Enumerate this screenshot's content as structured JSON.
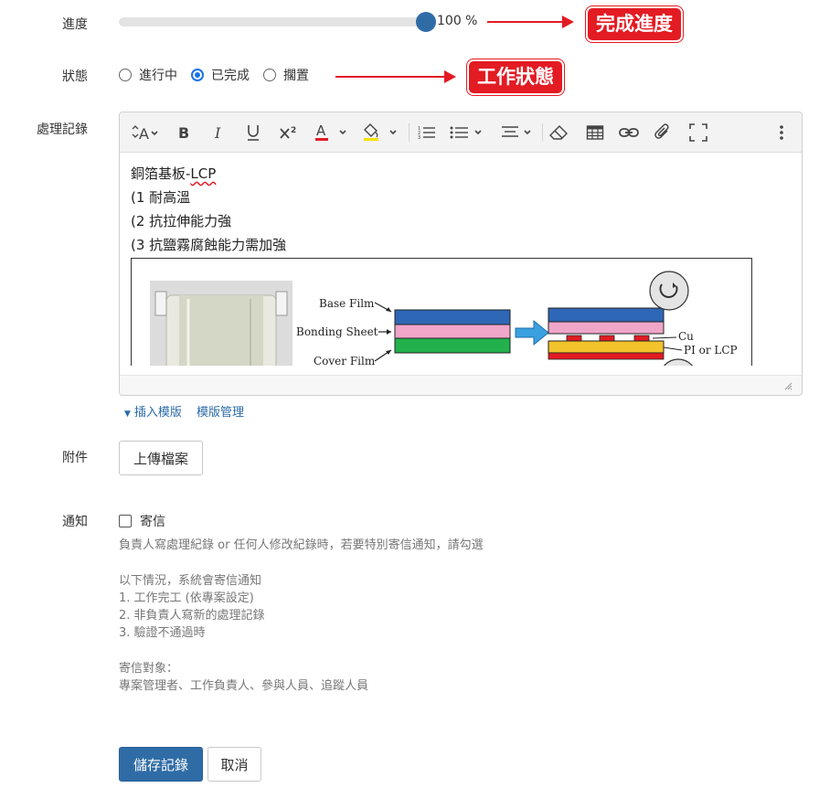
{
  "progress": {
    "label": "進度",
    "value": 1.0,
    "value_text": "100 %"
  },
  "callouts": {
    "progress": "完成進度",
    "status": "工作狀態"
  },
  "status": {
    "label": "狀態",
    "options": [
      {
        "label": "進行中",
        "selected": false
      },
      {
        "label": "已完成",
        "selected": true
      },
      {
        "label": "擱置",
        "selected": false
      }
    ]
  },
  "record": {
    "label": "處理記錄",
    "toolbar": [
      "font-size-icon",
      "bold-icon",
      "italic-icon",
      "underline-icon",
      "superscript-icon",
      "text-color-icon",
      "highlight-icon",
      "ordered-list-icon",
      "bullet-list-icon",
      "align-icon",
      "eraser-icon",
      "table-icon",
      "link-icon",
      "attachment-icon",
      "fullscreen-icon",
      "more-icon"
    ],
    "lines": [
      "銅箔基板-",
      "LCP",
      "(1 耐高溫",
      "(2 抗拉伸能力強",
      "(3 抗鹽霧腐蝕能力需加強"
    ],
    "figure_labels": {
      "base_film": "Base Film",
      "bonding_sheet": "Bonding Sheet",
      "cover_film": "Cover Film",
      "cu": "Cu",
      "pi_lcp": "PI or LCP"
    },
    "template_insert": "插入模版",
    "template_manage": "模版管理"
  },
  "attachment": {
    "label": "附件",
    "upload_button": "上傳檔案"
  },
  "notify": {
    "label": "通知",
    "checkbox_label": "寄信",
    "checked": false,
    "help_1": "負責人寫處理紀錄 or 任何人修改紀錄時，若要特別寄信通知，請勾選",
    "help_2": "以下情況，系統會寄信通知",
    "help_3": "1. 工作完工 (依專案設定)",
    "help_4": "2. 非負責人寫新的處理記錄",
    "help_5": "3. 驗證不通過時",
    "help_6": "寄信對象：",
    "help_7": "專案管理者、工作負責人、參與人員、追蹤人員"
  },
  "actions": {
    "save": "儲存記錄",
    "cancel": "取消"
  },
  "colors": {
    "primary": "#2f6ca6",
    "callout": "#e31b23",
    "link": "#2a6aa8"
  }
}
